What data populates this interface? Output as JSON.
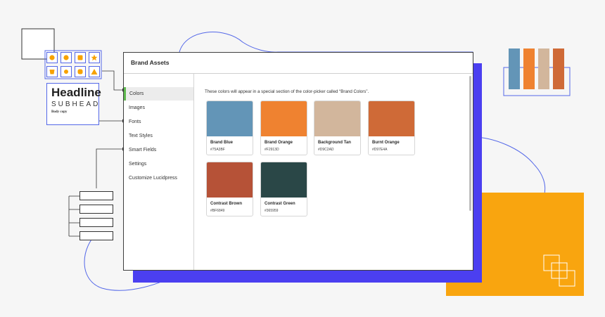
{
  "window": {
    "title": "Brand Assets"
  },
  "sidebar": {
    "items": [
      {
        "label": "Colors",
        "active": true
      },
      {
        "label": "Images",
        "active": false
      },
      {
        "label": "Fonts",
        "active": false
      },
      {
        "label": "Text Styles",
        "active": false
      },
      {
        "label": "Smart Fields",
        "active": false
      },
      {
        "label": "Settings",
        "active": false
      },
      {
        "label": "Customize Lucidpress",
        "active": false
      }
    ]
  },
  "content": {
    "description": "These colors will appear in a special section of the color-picker called “Brand Colors”.",
    "colors": [
      {
        "name": "Brand Blue",
        "hex": "#75A3BF",
        "swatch": "#6395b7"
      },
      {
        "name": "Brand Orange",
        "hex": "#F2913D",
        "swatch": "#ef8230"
      },
      {
        "name": "Background Tan",
        "hex": "#D9C2AD",
        "swatch": "#d2b69c"
      },
      {
        "name": "Burnt Orange",
        "hex": "#D97E4A",
        "swatch": "#cf6a37"
      },
      {
        "name": "Contrast Brown",
        "hex": "#BF6849",
        "swatch": "#b65237"
      },
      {
        "name": "Contrast Green",
        "hex": "#365959",
        "swatch": "#2a4747"
      }
    ]
  },
  "decor": {
    "headline": "Headline",
    "subhead": "SUBHEAD",
    "body_copy": "Body copy",
    "icons": [
      "circle-icon",
      "circle-icon",
      "square-icon",
      "star-icon",
      "bucket-icon",
      "circle-icon",
      "rounded-square-icon",
      "triangle-icon"
    ],
    "accent_blue": "#4b3ff0",
    "accent_yellow": "#f9a50f",
    "icon_orange": "#f7a200",
    "line_blue": "#5468e8"
  }
}
